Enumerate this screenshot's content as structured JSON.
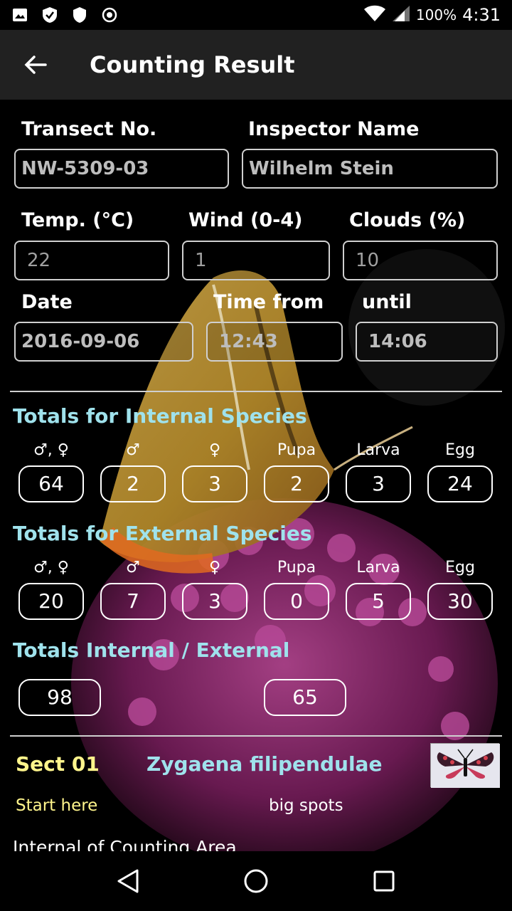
{
  "status": {
    "battery": "100%",
    "time": "4:31"
  },
  "app_bar": {
    "title": "Counting Result"
  },
  "header_fields": {
    "transect_label": "Transect No.",
    "transect_value": "NW-5309-03",
    "inspector_label": "Inspector Name",
    "inspector_value": "Wilhelm Stein",
    "temp_label": "Temp. (°C)",
    "temp_value": "22",
    "wind_label": "Wind (0-4)",
    "wind_value": "1",
    "clouds_label": "Clouds (%)",
    "clouds_value": "10",
    "date_label": "Date",
    "date_value": "2016-09-06",
    "time_from_label": "Time from",
    "time_from_value": "12:43",
    "until_label": "until",
    "until_value": "14:06"
  },
  "columns": [
    "♂, ♀",
    "♂",
    "♀",
    "Pupa",
    "Larva",
    "Egg"
  ],
  "internal": {
    "title": "Totals for Internal Species",
    "values": [
      "64",
      "2",
      "3",
      "2",
      "3",
      "24"
    ]
  },
  "external": {
    "title": "Totals for External Species",
    "values": [
      "20",
      "7",
      "3",
      "0",
      "5",
      "30"
    ]
  },
  "totals": {
    "title": "Totals Internal / External",
    "internal": "98",
    "external": "65"
  },
  "section": {
    "label": "Sect 01",
    "species": "Zygaena filipendulae",
    "note_left": "Start here",
    "note_right": "big spots",
    "bottom_text": "Internal of Counting Area"
  },
  "colors": {
    "accent_cyan": "#9fe2ec",
    "accent_yellow": "#fff58c",
    "appbar": "#212121"
  }
}
